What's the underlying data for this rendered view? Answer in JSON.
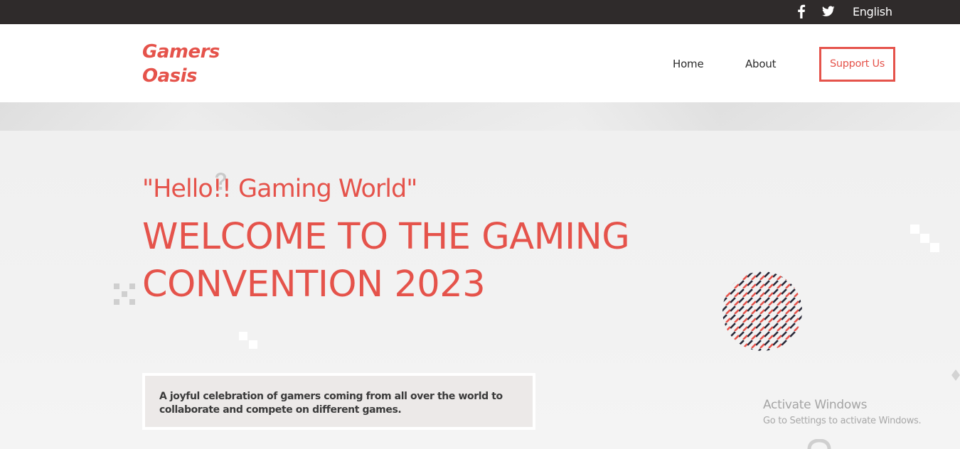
{
  "topbar": {
    "social": [
      {
        "icon": "facebook-icon"
      },
      {
        "icon": "twitter-icon"
      }
    ],
    "language": "English"
  },
  "header": {
    "logo": "Gamers Oasis",
    "nav": {
      "home": "Home",
      "about": "About",
      "support": "Support Us"
    }
  },
  "hero": {
    "greeting": "\"Hello!! Gaming World\"",
    "title": "WELCOME TO THE GAMING CONVENTION 2023",
    "description": "A joyful celebration of gamers coming from all over the world to collaborate and compete on different games."
  },
  "os_watermark": {
    "title": "Activate Windows",
    "subtitle": "Go to Settings to activate Windows."
  },
  "colors": {
    "accent": "#e5534b",
    "topbar_bg": "#2f2b2b",
    "text_dark": "#2c2c2c",
    "desc_bg": "#ece9e8",
    "pattern_dark": "#2b2b3a"
  }
}
